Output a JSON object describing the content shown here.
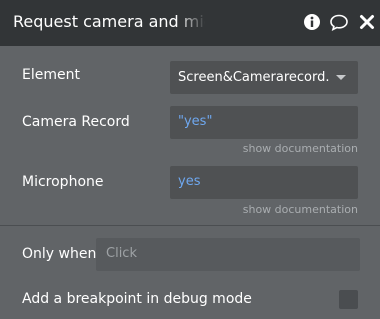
{
  "header": {
    "title": "Request camera and microphone",
    "icons": [
      "info-icon",
      "comment-icon",
      "close-icon"
    ]
  },
  "fields": {
    "element": {
      "label": "Element",
      "value": "Screen&Camerarecord..."
    },
    "camera_record": {
      "label": "Camera Record",
      "value": "\"yes\"",
      "help": "show documentation"
    },
    "microphone": {
      "label": "Microphone",
      "value": "yes",
      "help": "show documentation"
    }
  },
  "conditions": {
    "only_when_label": "Only when",
    "only_when_placeholder": "Click",
    "breakpoint_label": "Add a breakpoint in debug mode"
  },
  "colors": {
    "header_bg": "#323537",
    "panel_bg": "#616467",
    "value_blue": "#6fa8f0"
  }
}
